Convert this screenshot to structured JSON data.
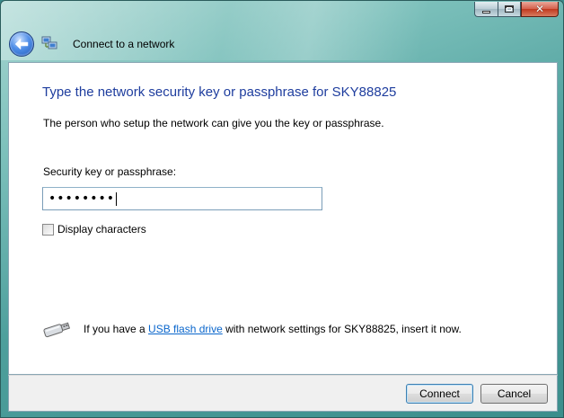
{
  "window": {
    "title": "Connect to a network",
    "caption": {
      "minimize_icon": "minimize-icon",
      "maximize_icon": "maximize-icon",
      "close_glyph": "✕"
    }
  },
  "nav": {
    "back_icon": "back-arrow-icon",
    "network_icon": "network-icon"
  },
  "content": {
    "heading": "Type the network security key or passphrase for SKY88825",
    "subtext": "The person who setup the network can give you the key or passphrase.",
    "key_label": "Security key or passphrase:",
    "key_value": "••••••••",
    "display_characters_label": "Display characters",
    "display_characters_checked": false,
    "usb": {
      "prefix": "If you have a ",
      "link": "USB flash drive",
      "suffix": " with network settings for SKY88825, insert it now."
    }
  },
  "buttons": {
    "connect": "Connect",
    "cancel": "Cancel"
  },
  "colors": {
    "heading": "#1e3d9e",
    "link": "#0a66cc",
    "glass": "#4d9f9c"
  }
}
